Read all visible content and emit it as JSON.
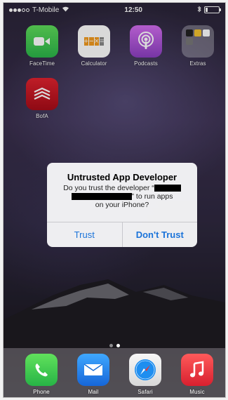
{
  "status_bar": {
    "carrier": "T-Mobile",
    "time": "12:50"
  },
  "apps": [
    {
      "label": "FaceTime",
      "icon": "facetime-icon"
    },
    {
      "label": "Calculator",
      "icon": "calculator-icon"
    },
    {
      "label": "Podcasts",
      "icon": "podcasts-icon"
    },
    {
      "label": "Extras",
      "icon": "folder-icon"
    },
    {
      "label": "BofA",
      "icon": "bofa-icon"
    }
  ],
  "alert": {
    "title": "Untrusted App Developer",
    "message_part1": "Do you trust the developer “",
    "message_part2": "” to run apps",
    "message_part3": "on your iPhone?",
    "trust_label": "Trust",
    "dont_trust_label": "Don't Trust"
  },
  "page_indicator": {
    "pages": 2,
    "current": 2
  },
  "dock": [
    {
      "label": "Phone",
      "icon": "phone-icon"
    },
    {
      "label": "Mail",
      "icon": "mail-icon"
    },
    {
      "label": "Safari",
      "icon": "safari-icon"
    },
    {
      "label": "Music",
      "icon": "music-icon"
    }
  ],
  "colors": {
    "link_blue": "#1a73d9"
  }
}
